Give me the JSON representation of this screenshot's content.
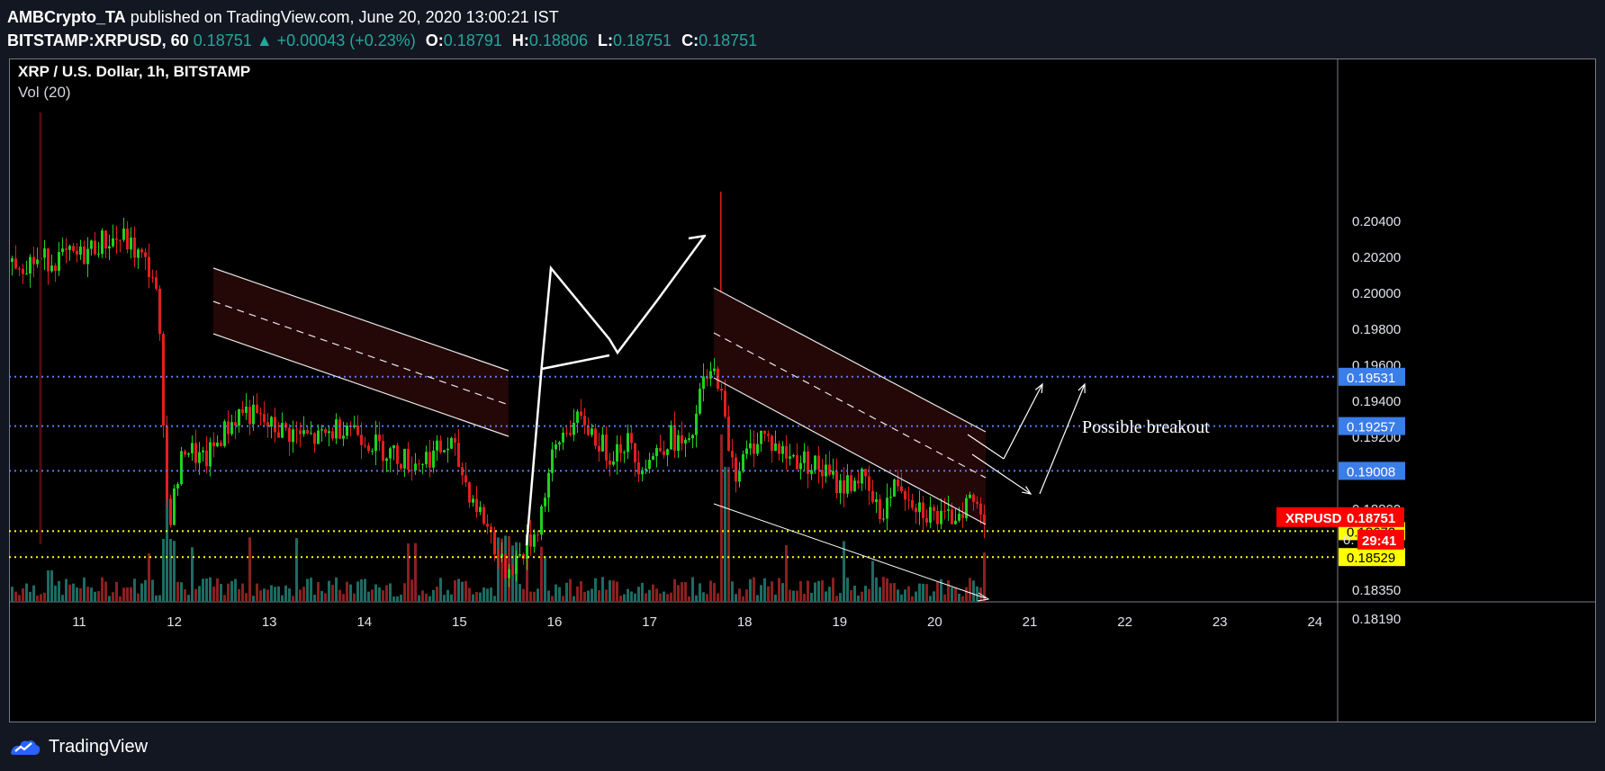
{
  "header": {
    "author": "AMBCrypto_TA",
    "published": "published on TradingView.com, June 20, 2020 13:00:21 IST",
    "symbol": "BITSTAMP:XRPUSD, 60",
    "last": "0.18751",
    "change_arrow": "▲",
    "change": "+0.00043 (+0.23%)",
    "o_label": "O:",
    "o": "0.18791",
    "h_label": "H:",
    "h": "0.18806",
    "l_label": "L:",
    "l": "0.18751",
    "c_label": "C:",
    "c": "0.18751"
  },
  "footer": {
    "brand": "TradingView",
    "logo_icon": "tradingview-logo-icon"
  },
  "colors": {
    "up": "#26a69a",
    "up_candle": "#1fd11f",
    "down": "#e01f1f",
    "vol_up": "#1d6b63",
    "vol_down": "#8a2020",
    "blue_line": "#5b7cf0",
    "yellow_line": "#ffff00",
    "channel_fill": "#2a0808",
    "price_tag_red": "#ff0000",
    "price_tag_blue": "#3b7de9",
    "price_tag_yellow": "#ffff00"
  },
  "chart_data": {
    "type": "candlestick",
    "title": "XRP / U.S. Dollar, 1h, BITSTAMP",
    "indicator": "Vol (20)",
    "x_ticks": [
      "11",
      "12",
      "13",
      "14",
      "15",
      "16",
      "17",
      "18",
      "19",
      "20",
      "21",
      "22",
      "23",
      "24"
    ],
    "x_tick_days": [
      11,
      12,
      13,
      14,
      15,
      16,
      17,
      18,
      19,
      20,
      21,
      22,
      23,
      24
    ],
    "y_ticks": [
      "0.20400",
      "0.20200",
      "0.20000",
      "0.19800",
      "0.19600",
      "0.19400",
      "0.19200",
      "0.18800",
      "0.18350",
      "0.18190"
    ],
    "ylim": [
      0.1805,
      0.2053
    ],
    "xlim": [
      10.35,
      24.75
    ],
    "horizontal_lines": [
      {
        "price": 0.19531,
        "label": "0.19531",
        "style": "blue-dotted"
      },
      {
        "price": 0.19257,
        "label": "0.19257",
        "style": "blue-dotted"
      },
      {
        "price": 0.19008,
        "label": "0.19008",
        "style": "blue-dotted"
      },
      {
        "price": 0.18673,
        "label": "0.18673",
        "style": "yellow-dotted"
      },
      {
        "price": 0.18529,
        "label": "0.18529",
        "style": "yellow-dotted"
      }
    ],
    "last_price_tag": {
      "symbol": "XRPUSD",
      "price": "0.18751",
      "countdown": "29:41",
      "hidden_prefix": "0."
    },
    "annotation": "Possible breakout",
    "price_anchors": [
      {
        "day": 10.4,
        "price": 0.2017
      },
      {
        "day": 10.8,
        "price": 0.2019
      },
      {
        "day": 11.0,
        "price": 0.202
      },
      {
        "day": 11.2,
        "price": 0.2028
      },
      {
        "day": 11.45,
        "price": 0.203
      },
      {
        "day": 11.65,
        "price": 0.2018
      },
      {
        "day": 11.78,
        "price": 0.2008
      },
      {
        "day": 11.85,
        "price": 0.196
      },
      {
        "day": 11.92,
        "price": 0.187
      },
      {
        "day": 12.0,
        "price": 0.189
      },
      {
        "day": 12.1,
        "price": 0.1915
      },
      {
        "day": 12.3,
        "price": 0.1905
      },
      {
        "day": 12.5,
        "price": 0.1922
      },
      {
        "day": 12.7,
        "price": 0.1935
      },
      {
        "day": 13.0,
        "price": 0.1925
      },
      {
        "day": 13.5,
        "price": 0.1918
      },
      {
        "day": 13.8,
        "price": 0.1928
      },
      {
        "day": 14.1,
        "price": 0.1915
      },
      {
        "day": 14.5,
        "price": 0.1905
      },
      {
        "day": 14.9,
        "price": 0.1915
      },
      {
        "day": 15.1,
        "price": 0.1888
      },
      {
        "day": 15.3,
        "price": 0.1868
      },
      {
        "day": 15.45,
        "price": 0.1845
      },
      {
        "day": 15.6,
        "price": 0.1852
      },
      {
        "day": 15.8,
        "price": 0.1868
      },
      {
        "day": 15.95,
        "price": 0.1905
      },
      {
        "day": 16.1,
        "price": 0.1925
      },
      {
        "day": 16.3,
        "price": 0.1928
      },
      {
        "day": 16.55,
        "price": 0.191
      },
      {
        "day": 16.75,
        "price": 0.1918
      },
      {
        "day": 16.85,
        "price": 0.1905
      },
      {
        "day": 17.0,
        "price": 0.1908
      },
      {
        "day": 17.2,
        "price": 0.192
      },
      {
        "day": 17.4,
        "price": 0.1912
      },
      {
        "day": 17.55,
        "price": 0.195
      },
      {
        "day": 17.7,
        "price": 0.1955
      },
      {
        "day": 17.8,
        "price": 0.192
      },
      {
        "day": 17.9,
        "price": 0.19
      },
      {
        "day": 18.15,
        "price": 0.1922
      },
      {
        "day": 18.4,
        "price": 0.191
      },
      {
        "day": 18.7,
        "price": 0.1905
      },
      {
        "day": 19.0,
        "price": 0.1892
      },
      {
        "day": 19.2,
        "price": 0.1898
      },
      {
        "day": 19.4,
        "price": 0.1876
      },
      {
        "day": 19.6,
        "price": 0.1895
      },
      {
        "day": 19.85,
        "price": 0.188
      },
      {
        "day": 20.1,
        "price": 0.1872
      },
      {
        "day": 20.35,
        "price": 0.1885
      },
      {
        "day": 20.55,
        "price": 0.18751
      }
    ]
  }
}
